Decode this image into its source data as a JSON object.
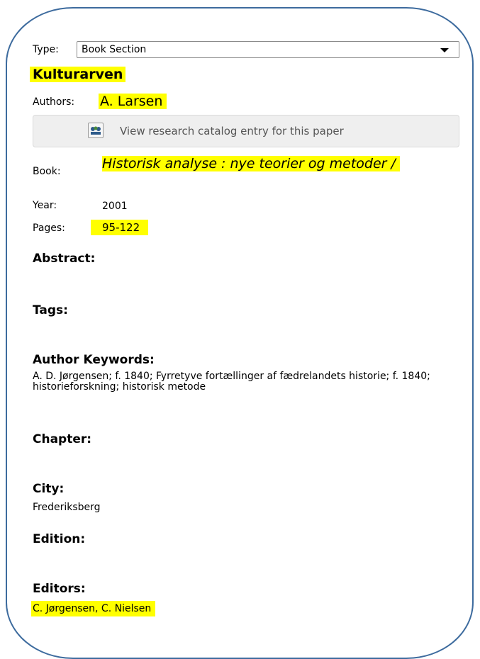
{
  "type": {
    "label": "Type:",
    "value": "Book Section"
  },
  "title": "Kulturarven",
  "authors": {
    "label": "Authors:",
    "value": "A. Larsen"
  },
  "catalog_button": {
    "label": "View research catalog entry for this paper",
    "icon": "catalog-icon"
  },
  "book": {
    "label": "Book:",
    "value": "Historisk analyse : nye teorier og metoder /"
  },
  "year": {
    "label": "Year:",
    "value": "2001"
  },
  "pages": {
    "label": "Pages:",
    "value": "95-122"
  },
  "abstract": {
    "heading": "Abstract:",
    "value": ""
  },
  "tags": {
    "heading": "Tags:",
    "value": ""
  },
  "author_keywords": {
    "heading": "Author Keywords:",
    "value": "A. D. Jørgensen; f. 1840; Fyrretyve fortællinger af fædrelandets historie; f. 1840; historieforskning; historisk metode"
  },
  "chapter": {
    "heading": "Chapter:",
    "value": ""
  },
  "city": {
    "heading": "City:",
    "value": "Frederiksberg"
  },
  "edition": {
    "heading": "Edition:",
    "value": ""
  },
  "editors": {
    "heading": "Editors:",
    "value": "C. Jørgensen, C. Nielsen"
  },
  "colors": {
    "highlight": "#ffff00",
    "frame": "#3d6b9e"
  }
}
